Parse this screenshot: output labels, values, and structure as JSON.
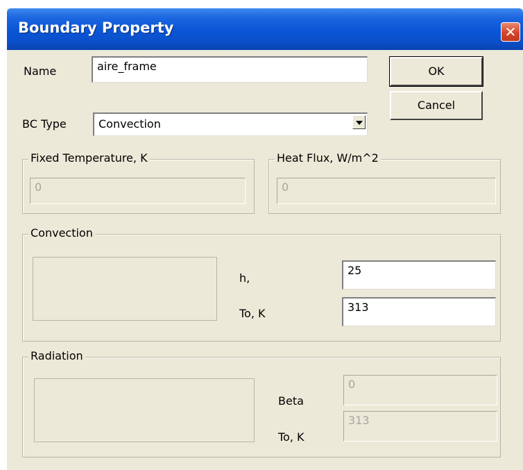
{
  "window": {
    "title": "Boundary Property",
    "close_glyph": "✕"
  },
  "name_field": {
    "label": "Name",
    "value": "aire_frame"
  },
  "buttons": {
    "ok": "OK",
    "cancel": "Cancel"
  },
  "bc_type": {
    "label": "BC Type",
    "selected": "Convection"
  },
  "fixed_temperature": {
    "legend": "Fixed Temperature, K",
    "value": "0"
  },
  "heat_flux": {
    "legend": "Heat Flux, W/m^2",
    "value": "0"
  },
  "convection": {
    "legend": "Convection",
    "h_label": "h,",
    "h_value": "25",
    "to_label": "To, K",
    "to_value": "313"
  },
  "radiation": {
    "legend": "Radiation",
    "beta_label": "Beta",
    "beta_value": "0",
    "to_label": "To, K",
    "to_value": "313"
  },
  "colors": {
    "titlebar": "#0a55d6",
    "dialog_bg": "#ece9d8",
    "close_button": "#d5452a",
    "disabled_text": "#a8a69c"
  }
}
